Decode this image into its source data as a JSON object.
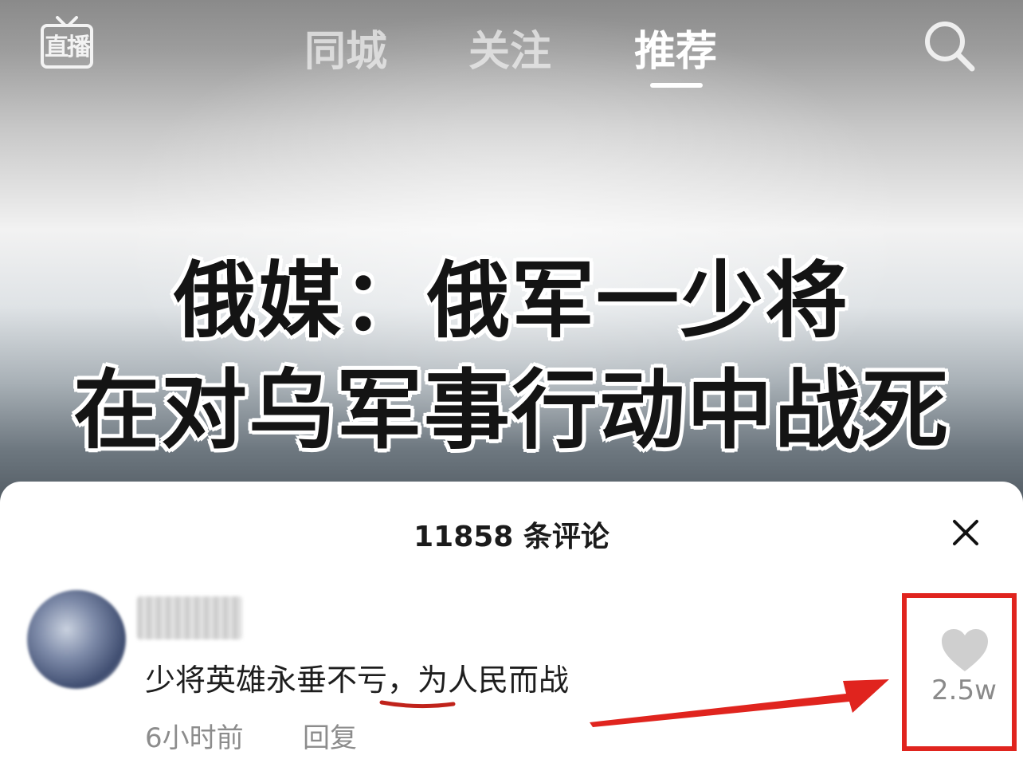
{
  "topnav": {
    "live_label": "直播",
    "tabs": [
      {
        "label": "同城",
        "active": false
      },
      {
        "label": "关注",
        "active": false
      },
      {
        "label": "推荐",
        "active": true
      }
    ]
  },
  "video": {
    "headline_line1": "俄媒：俄军一少将",
    "headline_line2": "在对乌军事行动中战死"
  },
  "comments": {
    "title": "11858 条评论",
    "items": [
      {
        "text": "少将英雄永垂不亏，为人民而战",
        "time": "6小时前",
        "reply_label": "回复",
        "like_count": "2.5w"
      }
    ]
  },
  "colors": {
    "highlight_red": "#e0241e",
    "annotation_underline": "#c0231b"
  }
}
